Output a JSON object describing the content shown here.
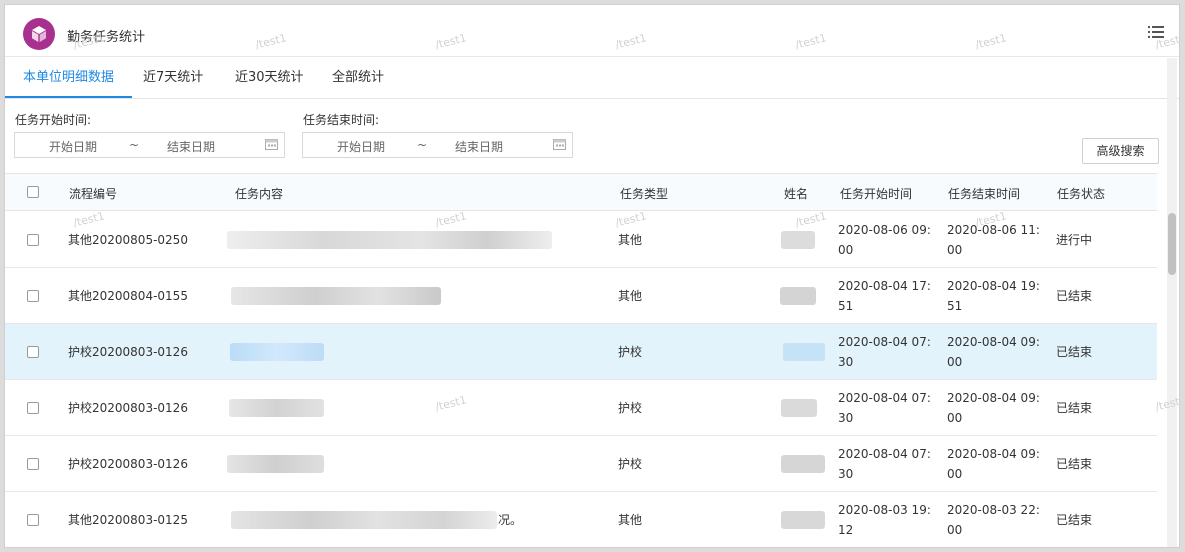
{
  "app": {
    "title": "勤务任务统计",
    "logo_icon": "cube-icon",
    "menu_icon": "list-menu-icon",
    "brand_color": "#a8318f",
    "accent_color": "#1e88e5"
  },
  "watermark": "/test1",
  "tabs": [
    {
      "label": "本单位明细数据",
      "active": true
    },
    {
      "label": "近7天统计",
      "active": false
    },
    {
      "label": "近30天统计",
      "active": false
    },
    {
      "label": "全部统计",
      "active": false
    }
  ],
  "filters": {
    "start": {
      "label": "任务开始时间:",
      "from_placeholder": "开始日期",
      "separator": "~",
      "to_placeholder": "结束日期"
    },
    "end": {
      "label": "任务结束时间:",
      "from_placeholder": "开始日期",
      "separator": "~",
      "to_placeholder": "结束日期"
    },
    "advanced_search": "高级搜索"
  },
  "table": {
    "columns": [
      "流程编号",
      "任务内容",
      "任务类型",
      "姓名",
      "任务开始时间",
      "任务结束时间",
      "任务状态"
    ],
    "rows": [
      {
        "id": "其他20200805-0250",
        "content": "",
        "type": "其他",
        "name": "",
        "start": "2020-08-06 09:00",
        "end": "2020-08-06 11:00",
        "status": "进行中"
      },
      {
        "id": "其他20200804-0155",
        "content": "",
        "type": "其他",
        "name": "",
        "start": "2020-08-04 17:51",
        "end": "2020-08-04 19:51",
        "status": "已结束"
      },
      {
        "id": "护校20200803-0126",
        "content": "",
        "type": "护校",
        "name": "",
        "start": "2020-08-04 07:30",
        "end": "2020-08-04 09:00",
        "status": "已结束"
      },
      {
        "id": "护校20200803-0126",
        "content": "",
        "type": "护校",
        "name": "",
        "start": "2020-08-04 07:30",
        "end": "2020-08-04 09:00",
        "status": "已结束"
      },
      {
        "id": "护校20200803-0126",
        "content": "",
        "type": "护校",
        "name": "",
        "start": "2020-08-04 07:30",
        "end": "2020-08-04 09:00",
        "status": "已结束"
      },
      {
        "id": "其他20200803-0125",
        "content": "况。",
        "type": "其他",
        "name": "",
        "start": "2020-08-03 19:12",
        "end": "2020-08-03 22:00",
        "status": "已结束"
      }
    ]
  }
}
